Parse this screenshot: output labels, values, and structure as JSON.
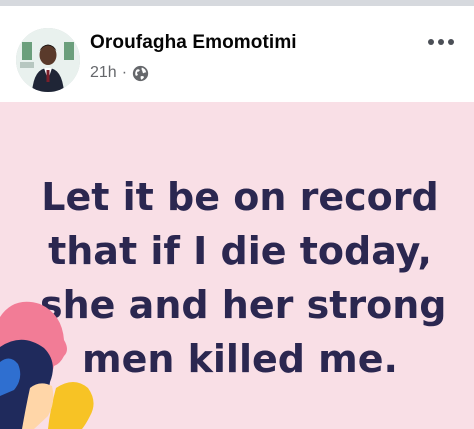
{
  "post": {
    "author_name": "Oroufagha Emomotimi",
    "time": "21h",
    "separator": "·",
    "privacy_icon": "globe-icon",
    "more_icon": "more-options-icon",
    "text_lines": [
      "Let it be on record",
      "that if I die today,",
      "she and her strong",
      "men killed me."
    ]
  },
  "colors": {
    "card_background": "#f9dfe6",
    "post_text": "#2b2750",
    "author_text": "#050505",
    "meta_text": "#65676b"
  }
}
